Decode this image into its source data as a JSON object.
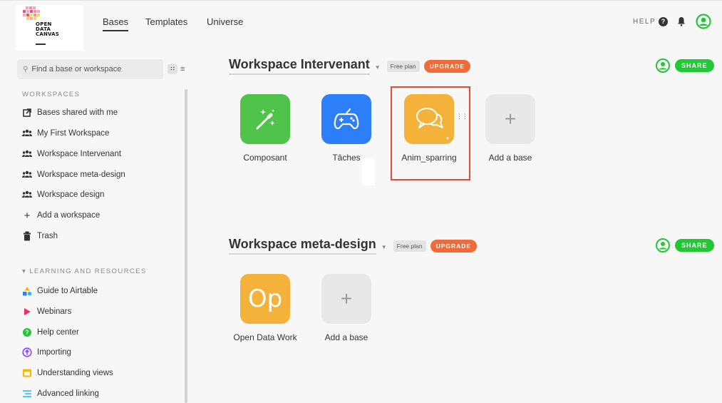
{
  "logo": {
    "lines": [
      "OPEN",
      "DATA",
      "CANVAS"
    ]
  },
  "nav": {
    "bases": "Bases",
    "templates": "Templates",
    "universe": "Universe"
  },
  "topright": {
    "help": "HELP"
  },
  "sidebar": {
    "search_placeholder": "Find a base or workspace",
    "workspaces_title": "WORKSPACES",
    "workspace_items": [
      {
        "label": "Bases shared with me",
        "icon": "shared-icon"
      },
      {
        "label": "My First Workspace",
        "icon": "people-icon"
      },
      {
        "label": "Workspace Intervenant",
        "icon": "people-icon"
      },
      {
        "label": "Workspace meta-design",
        "icon": "people-icon"
      },
      {
        "label": "Workspace design",
        "icon": "people-icon"
      },
      {
        "label": "Add a workspace",
        "icon": "plus-icon"
      },
      {
        "label": "Trash",
        "icon": "trash-icon"
      }
    ],
    "resources_title": "LEARNING AND RESOURCES",
    "resource_items": [
      {
        "label": "Guide to Airtable",
        "icon": "shapes-icon"
      },
      {
        "label": "Webinars",
        "icon": "play-icon"
      },
      {
        "label": "Help center",
        "icon": "help-circle-icon"
      },
      {
        "label": "Importing",
        "icon": "upload-icon"
      },
      {
        "label": "Understanding views",
        "icon": "views-icon"
      },
      {
        "label": "Advanced linking",
        "icon": "linking-icon"
      }
    ]
  },
  "workspaces": [
    {
      "title": "Workspace Intervenant",
      "plan": "Free plan",
      "upgrade": "UPGRADE",
      "share": "SHARE",
      "bases": [
        {
          "name": "Composant",
          "color": "#4fc24a",
          "icon": "magic-wand-icon"
        },
        {
          "name": "Tâches",
          "color": "#2d7ff9",
          "icon": "gamepad-icon"
        },
        {
          "name": "Anim_sparring",
          "color": "#f4b23a",
          "icon": "chat-bubbles-icon"
        },
        {
          "name": "Add a base",
          "icon": "plus-icon"
        }
      ]
    },
    {
      "title": "Workspace meta-design",
      "plan": "Free plan",
      "upgrade": "UPGRADE",
      "share": "SHARE",
      "bases": [
        {
          "name": "Open Data Work",
          "color": "#f4b23a",
          "tile_text": "Op"
        },
        {
          "name": "Add a base",
          "icon": "plus-icon"
        }
      ]
    }
  ],
  "colors": {
    "accent_green": "#20c933",
    "upgrade_orange": "#f16b3a",
    "highlight_red": "#e04b3c"
  }
}
